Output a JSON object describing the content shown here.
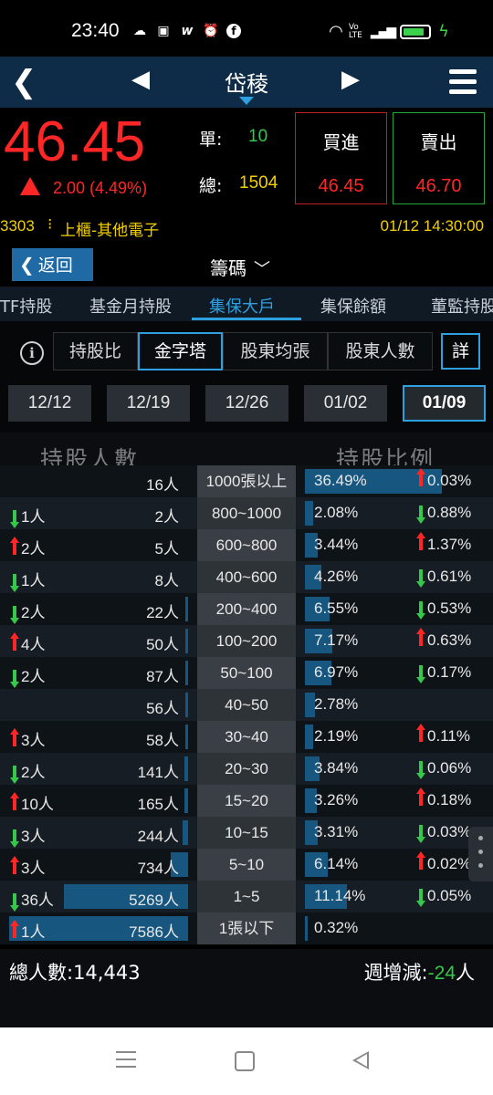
{
  "status_bar": {
    "time": "23:40",
    "icons": [
      "cloud-icon",
      "chat-icon",
      "w-icon",
      "alarm-icon",
      "facebook-icon"
    ],
    "right_icons": [
      "wifi-icon",
      "volte-icon",
      "signal-icon",
      "battery-icon",
      "charging-icon"
    ],
    "volte": "Vo LTE"
  },
  "nav": {
    "title": "岱稜"
  },
  "quote": {
    "price": "46.45",
    "change": "2.00 (4.49%)",
    "single_label": "單:",
    "single_value": "10",
    "total_label": "總:",
    "total_value": "1504",
    "buy_label": "買進",
    "buy_price": "46.45",
    "sell_label": "賣出",
    "sell_price": "46.70",
    "colors": {
      "up": "#ff2626",
      "down": "#35c84b",
      "accent": "#2ea0e0",
      "yellow": "#f2d000"
    }
  },
  "info": {
    "code": "3303",
    "category": "上櫃-其他電子",
    "datetime": "01/12 14:30:00"
  },
  "header": {
    "return_label": "返回",
    "section_title": "籌碼"
  },
  "tabs": [
    {
      "label": "TF持股"
    },
    {
      "label": "基金月持股"
    },
    {
      "label": "集保大戶"
    },
    {
      "label": "集保餘額"
    },
    {
      "label": "董監持股"
    }
  ],
  "modes": {
    "buttons": [
      {
        "label": "持股比"
      },
      {
        "label": "金字塔"
      },
      {
        "label": "股東均張"
      },
      {
        "label": "股東人數"
      }
    ],
    "detail_label": "詳"
  },
  "dates": [
    "12/12",
    "12/19",
    "12/26",
    "01/02",
    "01/09"
  ],
  "table_headers": {
    "left": "持股人數",
    "right": "持股比例"
  },
  "rows": [
    {
      "chg": "",
      "dir": "",
      "count": "16人",
      "range": "1000張以上",
      "pct": "36.49%",
      "pct_dir": "up",
      "pct_chg": "0.03%",
      "count_fill": 0.0,
      "pct_fill": 0.365
    },
    {
      "chg": "1人",
      "dir": "down",
      "count": "2人",
      "range": "800~1000",
      "pct": "2.08%",
      "pct_dir": "down",
      "pct_chg": "0.88%",
      "count_fill": 0.0,
      "pct_fill": 0.0208
    },
    {
      "chg": "2人",
      "dir": "up",
      "count": "5人",
      "range": "600~800",
      "pct": "3.44%",
      "pct_dir": "up",
      "pct_chg": "1.37%",
      "count_fill": 0.0,
      "pct_fill": 0.0344
    },
    {
      "chg": "1人",
      "dir": "down",
      "count": "8人",
      "range": "400~600",
      "pct": "4.26%",
      "pct_dir": "down",
      "pct_chg": "0.61%",
      "count_fill": 0.0,
      "pct_fill": 0.0426
    },
    {
      "chg": "2人",
      "dir": "down",
      "count": "22人",
      "range": "200~400",
      "pct": "6.55%",
      "pct_dir": "down",
      "pct_chg": "0.53%",
      "count_fill": 0.003,
      "pct_fill": 0.0655
    },
    {
      "chg": "4人",
      "dir": "up",
      "count": "50人",
      "range": "100~200",
      "pct": "7.17%",
      "pct_dir": "up",
      "pct_chg": "0.63%",
      "count_fill": 0.007,
      "pct_fill": 0.0717
    },
    {
      "chg": "2人",
      "dir": "down",
      "count": "87人",
      "range": "50~100",
      "pct": "6.97%",
      "pct_dir": "down",
      "pct_chg": "0.17%",
      "count_fill": 0.011,
      "pct_fill": 0.0697
    },
    {
      "chg": "",
      "dir": "",
      "count": "56人",
      "range": "40~50",
      "pct": "2.78%",
      "pct_dir": "",
      "pct_chg": "",
      "count_fill": 0.007,
      "pct_fill": 0.0278
    },
    {
      "chg": "3人",
      "dir": "up",
      "count": "58人",
      "range": "30~40",
      "pct": "2.19%",
      "pct_dir": "up",
      "pct_chg": "0.11%",
      "count_fill": 0.008,
      "pct_fill": 0.0219
    },
    {
      "chg": "2人",
      "dir": "down",
      "count": "141人",
      "range": "20~30",
      "pct": "3.84%",
      "pct_dir": "down",
      "pct_chg": "0.06%",
      "count_fill": 0.019,
      "pct_fill": 0.0384
    },
    {
      "chg": "10人",
      "dir": "up",
      "count": "165人",
      "range": "15~20",
      "pct": "3.26%",
      "pct_dir": "up",
      "pct_chg": "0.18%",
      "count_fill": 0.022,
      "pct_fill": 0.0326
    },
    {
      "chg": "3人",
      "dir": "down",
      "count": "244人",
      "range": "10~15",
      "pct": "3.31%",
      "pct_dir": "down",
      "pct_chg": "0.03%",
      "count_fill": 0.032,
      "pct_fill": 0.0331
    },
    {
      "chg": "3人",
      "dir": "up",
      "count": "734人",
      "range": "5~10",
      "pct": "6.14%",
      "pct_dir": "up",
      "pct_chg": "0.02%",
      "count_fill": 0.097,
      "pct_fill": 0.0614
    },
    {
      "chg": "36人",
      "dir": "down",
      "count": "5269人",
      "range": "1~5",
      "pct": "11.14%",
      "pct_dir": "down",
      "pct_chg": "0.05%",
      "count_fill": 0.695,
      "pct_fill": 0.1114
    },
    {
      "chg": "1人",
      "dir": "up",
      "count": "7586人",
      "range": "1張以下",
      "pct": "0.32%",
      "pct_dir": "",
      "pct_chg": "",
      "count_fill": 1.0,
      "pct_fill": 0.0032
    }
  ],
  "totals": {
    "total_label": "總人數:14,443",
    "weekly_label": "週增減:",
    "weekly_value": "-24",
    "weekly_unit": "人"
  }
}
